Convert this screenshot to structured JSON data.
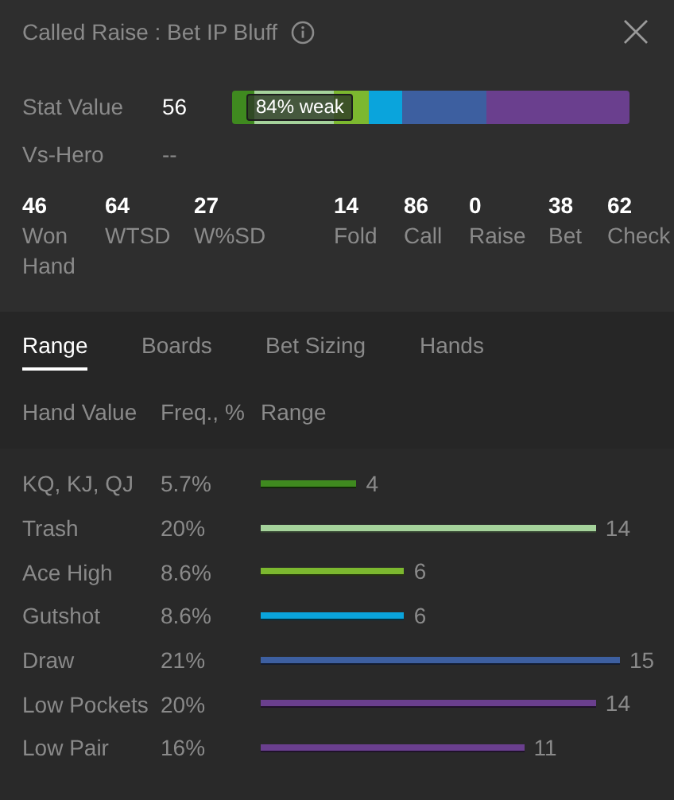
{
  "title": "Called Raise : Bet IP Bluff",
  "stat_value": {
    "label": "Stat Value",
    "value": "56",
    "badge": "84% weak"
  },
  "vs_hero": {
    "label": "Vs-Hero",
    "value": "--"
  },
  "stats_left": [
    {
      "value": "46",
      "label": "Won Hand"
    },
    {
      "value": "64",
      "label": "WTSD"
    },
    {
      "value": "27",
      "label": "W%SD"
    }
  ],
  "stats_right": [
    {
      "value": "14",
      "label": "Fold"
    },
    {
      "value": "86",
      "label": "Call"
    },
    {
      "value": "0",
      "label": "Raise"
    },
    {
      "value": "38",
      "label": "Bet"
    },
    {
      "value": "62",
      "label": "Check"
    }
  ],
  "tabs": [
    {
      "label": "Range",
      "selected": true
    },
    {
      "label": "Boards",
      "selected": false
    },
    {
      "label": "Bet Sizing",
      "selected": false
    },
    {
      "label": "Hands",
      "selected": false
    }
  ],
  "table": {
    "columns": [
      "Hand Value",
      "Freq., %",
      "Range"
    ],
    "rows": [
      {
        "hand_value": "KQ, KJ, QJ",
        "freq": "5.7%",
        "color": "#3f8a1f",
        "count": "4"
      },
      {
        "hand_value": "Trash",
        "freq": "20%",
        "color": "#a5d29b",
        "count": "14"
      },
      {
        "hand_value": "Ace High",
        "freq": "8.6%",
        "color": "#7cb82f",
        "count": "6"
      },
      {
        "hand_value": "Gutshot",
        "freq": "8.6%",
        "color": "#0aa4dc",
        "count": "6"
      },
      {
        "hand_value": "Draw",
        "freq": "21%",
        "color": "#3d5fa0",
        "count": "15"
      },
      {
        "hand_value": "Low Pockets",
        "freq": "20%",
        "color": "#6a3f8e",
        "count": "14"
      },
      {
        "hand_value": "Low Pair",
        "freq": "16%",
        "color": "#6a3f8e",
        "count": "11"
      }
    ]
  }
}
